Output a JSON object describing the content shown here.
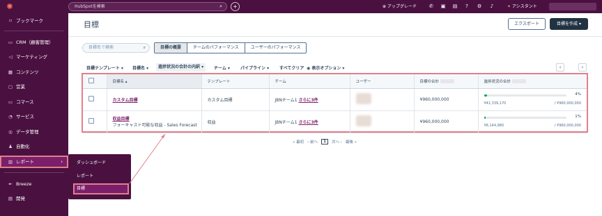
{
  "topbar": {
    "search_placeholder": "HubSpotを検索",
    "upgrade_label": "アップグレード",
    "assistant_label": "アシスタント"
  },
  "sidebar": {
    "items": [
      {
        "label": "ブックマーク",
        "icon": "bookmark-icon"
      },
      {
        "label": "CRM（顧客管理）",
        "icon": "contacts-icon"
      },
      {
        "label": "マーケティング",
        "icon": "megaphone-icon"
      },
      {
        "label": "コンテンツ",
        "icon": "content-icon"
      },
      {
        "label": "営業",
        "icon": "briefcase-icon"
      },
      {
        "label": "コマース",
        "icon": "cart-icon"
      },
      {
        "label": "サービス",
        "icon": "headset-icon"
      },
      {
        "label": "データ管理",
        "icon": "database-icon"
      },
      {
        "label": "自動化",
        "icon": "automation-icon"
      },
      {
        "label": "レポート",
        "icon": "reports-icon"
      },
      {
        "label": "Breeze",
        "icon": "breeze-icon"
      },
      {
        "label": "開発",
        "icon": "code-icon"
      }
    ],
    "flyout": [
      "ダッシュボード",
      "レポート",
      "目標"
    ]
  },
  "header": {
    "title": "目標",
    "export_label": "エクスポート",
    "create_label": "目標を作成 ▾"
  },
  "controls": {
    "search_placeholder": "目標名で検索",
    "tabs": [
      "目標の概要",
      "チームのパフォーマンス",
      "ユーザーのパフォーマンス"
    ],
    "filters": [
      "目標テンプレート ▾",
      "目標名 ▾",
      "進捗状況の合計の内訳 ▾",
      "チーム ▾",
      "パイプライン ▾",
      "すべてクリア",
      "表示オプション ▾"
    ]
  },
  "table": {
    "headers": [
      "目標名 ▴",
      "テンプレート",
      "チーム",
      "ユーザー",
      "目標の合計",
      "進捗状況の合計"
    ],
    "rows": [
      {
        "name": "カスタム目標",
        "subtitle": "",
        "template": "カスタム目標",
        "team": "JBNチーム1",
        "more": "さらに3件",
        "total": "¥960,000,000",
        "progress": 0.04,
        "pct_label": "4%",
        "current": "¥41,339,170",
        "target": "/ ¥960,000,000"
      },
      {
        "name": "収益目標",
        "subtitle": "フォーキャスト可能な収益 - Sales Forecast",
        "template": "収益",
        "team": "JBNチーム1",
        "more": "さらに3件",
        "total": "¥960,000,000",
        "progress": 0.01,
        "pct_label": "1%",
        "current": "¥8,144,980",
        "target": "/ ¥960,000,000"
      }
    ]
  },
  "pagination": {
    "first": "« 最初",
    "prev": "‹ 前へ",
    "page": "1",
    "next": "次へ ›",
    "last": "最後 »"
  },
  "colors": {
    "nav_bg": "#4a1140",
    "highlight": "#e0808c",
    "progress": "#00a35a"
  }
}
